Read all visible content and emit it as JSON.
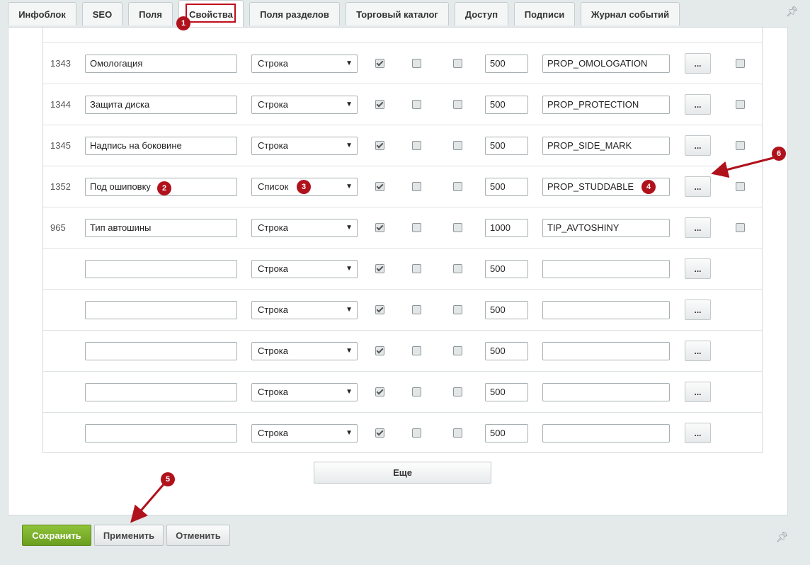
{
  "tabs": [
    "Инфоблок",
    "SEO",
    "Поля",
    "Свойства",
    "Поля разделов",
    "Торговый каталог",
    "Доступ",
    "Подписи",
    "Журнал событий"
  ],
  "active_tab": "Свойства",
  "rows": [
    {
      "id": "1343",
      "name": "Омологация",
      "type": "Строка",
      "c1": true,
      "c2": false,
      "c3": false,
      "sort": "500",
      "code": "PROP_OMOLOGATION",
      "last": true
    },
    {
      "id": "1344",
      "name": "Защита диска",
      "type": "Строка",
      "c1": true,
      "c2": false,
      "c3": false,
      "sort": "500",
      "code": "PROP_PROTECTION",
      "last": true
    },
    {
      "id": "1345",
      "name": "Надпись на боковине",
      "type": "Строка",
      "c1": true,
      "c2": false,
      "c3": false,
      "sort": "500",
      "code": "PROP_SIDE_MARK",
      "last": true
    },
    {
      "id": "1352",
      "name": "Под ошиповку",
      "type": "Список",
      "c1": true,
      "c2": false,
      "c3": false,
      "sort": "500",
      "code": "PROP_STUDDABLE",
      "last": true
    },
    {
      "id": "965",
      "name": "Тип автошины",
      "type": "Строка",
      "c1": true,
      "c2": false,
      "c3": false,
      "sort": "1000",
      "code": "TIP_AVTOSHINY",
      "last": true
    },
    {
      "id": "",
      "name": "",
      "type": "Строка",
      "c1": true,
      "c2": false,
      "c3": false,
      "sort": "500",
      "code": "",
      "last": null
    },
    {
      "id": "",
      "name": "",
      "type": "Строка",
      "c1": true,
      "c2": false,
      "c3": false,
      "sort": "500",
      "code": "",
      "last": null
    },
    {
      "id": "",
      "name": "",
      "type": "Строка",
      "c1": true,
      "c2": false,
      "c3": false,
      "sort": "500",
      "code": "",
      "last": null
    },
    {
      "id": "",
      "name": "",
      "type": "Строка",
      "c1": true,
      "c2": false,
      "c3": false,
      "sort": "500",
      "code": "",
      "last": null
    },
    {
      "id": "",
      "name": "",
      "type": "Строка",
      "c1": true,
      "c2": false,
      "c3": false,
      "sort": "500",
      "code": "",
      "last": null
    }
  ],
  "edit_button_label": "...",
  "more_label": "Еще",
  "buttons": {
    "save": "Сохранить",
    "apply": "Применить",
    "cancel": "Отменить"
  },
  "annotations": [
    "1",
    "2",
    "3",
    "4",
    "5",
    "6"
  ],
  "colors": {
    "annotation": "#b0121c",
    "save_button": "#7cb02c"
  },
  "icons": {
    "pin": "pin-icon",
    "dropdown": "chevron-down-icon"
  }
}
